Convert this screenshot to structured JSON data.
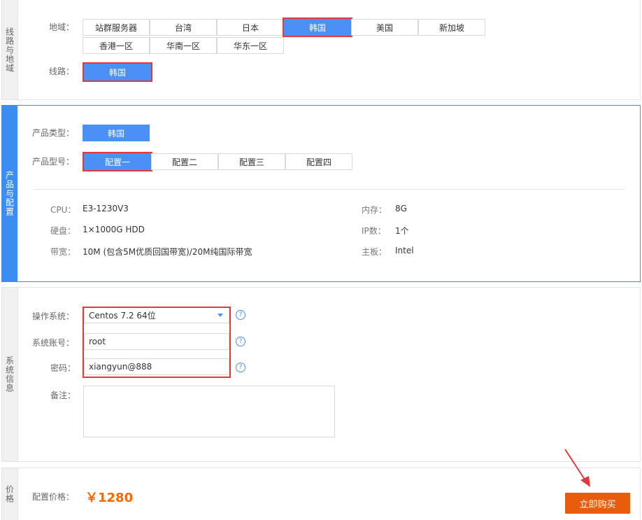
{
  "sections": {
    "region": "线路与地域",
    "product": "产品与配置",
    "system": "系统信息",
    "price": "价格"
  },
  "region": {
    "label": "地域：",
    "options": [
      "站群服务器",
      "台湾",
      "日本",
      "韩国",
      "美国",
      "新加坡",
      "香港一区",
      "华南一区",
      "华东一区"
    ],
    "selected": "韩国",
    "line_label": "线路：",
    "line_options": [
      "韩国"
    ]
  },
  "product": {
    "type_label": "产品类型：",
    "type_options": [
      "韩国"
    ],
    "model_label": "产品型号：",
    "model_options": [
      "配置一",
      "配置二",
      "配置三",
      "配置四"
    ],
    "selected_model": "配置一",
    "specs": {
      "cpu_k": "CPU：",
      "cpu_v": "E3-1230V3",
      "mem_k": "内存：",
      "mem_v": "8G",
      "disk_k": "硬盘：",
      "disk_v": "1×1000G HDD",
      "ip_k": "IP数：",
      "ip_v": "1个",
      "bw_k": "带宽：",
      "bw_v": "10M (包含5M优质回国带宽)/20M纯国际带宽",
      "board_k": "主板：",
      "board_v": "Intel"
    }
  },
  "system": {
    "os_label": "操作系统：",
    "os_value": "Centos 7.2 64位",
    "account_label": "系统账号：",
    "account_value": "root",
    "password_label": "密码：",
    "password_value": "xiangyun@888",
    "notes_label": "备注：",
    "help": "?"
  },
  "price": {
    "label": "配置价格：",
    "value": "￥1280",
    "buy_label": "立即购买"
  },
  "colors": {
    "accent": "#4a90f5",
    "highlight": "#e03a3a",
    "buy": "#e85d0c",
    "price": "#ff6600"
  }
}
